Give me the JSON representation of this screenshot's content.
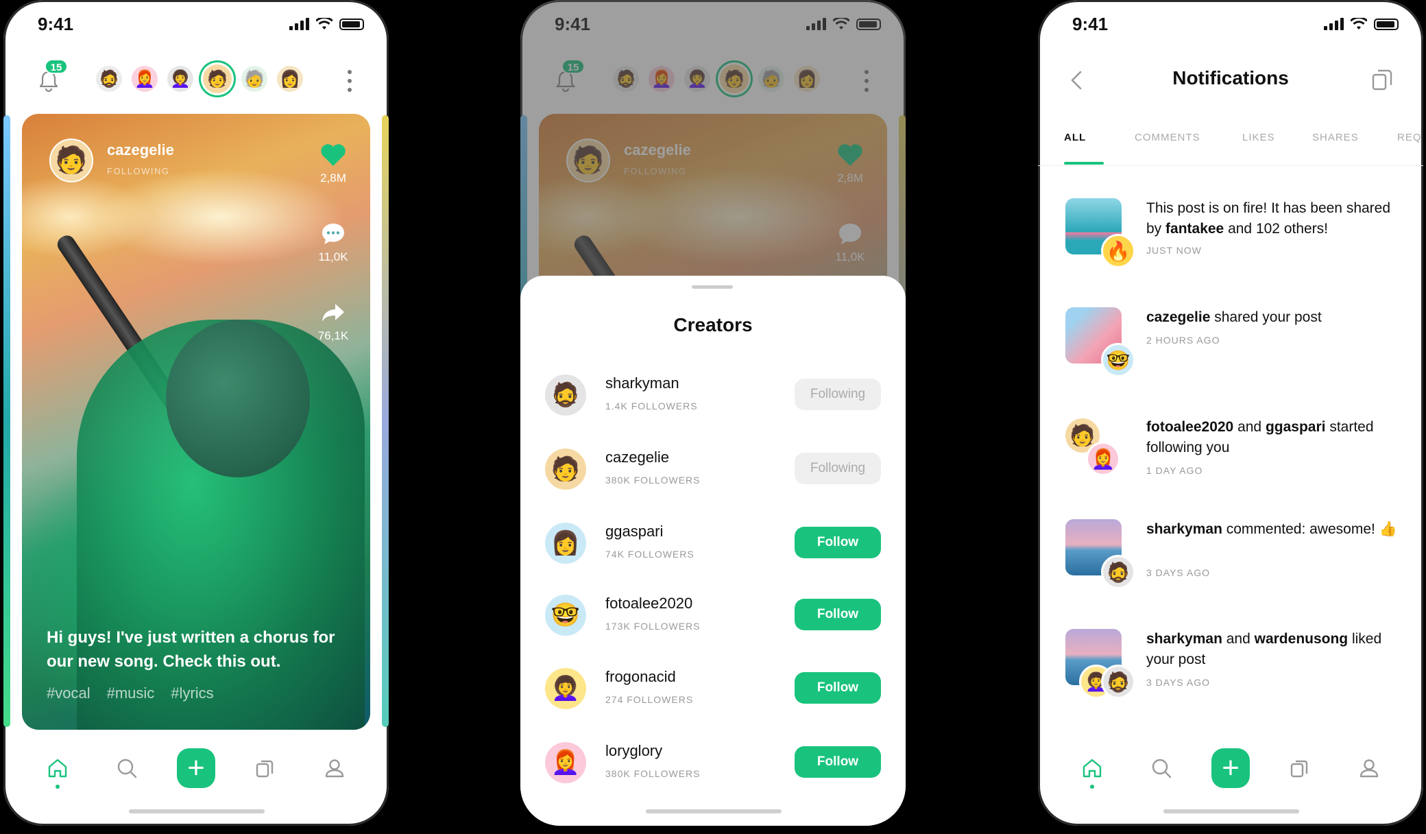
{
  "status": {
    "time": "9:41"
  },
  "feed": {
    "notification_count": "15",
    "stories": [
      "🧔",
      "👩‍🦰",
      "👩‍🦱",
      "🧑",
      "🧓",
      "👩"
    ],
    "post": {
      "username": "cazegelie",
      "follow_state": "FOLLOWING",
      "avatar": "🧑",
      "likes": "2,8M",
      "comments": "11,0K",
      "shares": "76,1K",
      "caption": "Hi guys! I've just written a chorus for our new song. Check this out.",
      "tags": [
        "#vocal",
        "#music",
        "#lyrics"
      ]
    }
  },
  "creators": {
    "title": "Creators",
    "items": [
      {
        "avatar": "🧔",
        "name": "sharkyman",
        "followers": "1.4K FOLLOWERS",
        "button": "Following",
        "following": true,
        "bg": "#e4e4e4"
      },
      {
        "avatar": "🧑",
        "name": "cazegelie",
        "followers": "380K FOLLOWERS",
        "button": "Following",
        "following": true,
        "bg": "#f6d9a2"
      },
      {
        "avatar": "👩",
        "name": "ggaspari",
        "followers": "74K FOLLOWERS",
        "button": "Follow",
        "following": false,
        "bg": "#c9e9f7"
      },
      {
        "avatar": "🤓",
        "name": "fotoalee2020",
        "followers": "173K FOLLOWERS",
        "button": "Follow",
        "following": false,
        "bg": "#c9e9f7"
      },
      {
        "avatar": "👩‍🦱",
        "name": "frogonacid",
        "followers": "274 FOLLOWERS",
        "button": "Follow",
        "following": false,
        "bg": "#fde58a"
      },
      {
        "avatar": "👩‍🦰",
        "name": "loryglory",
        "followers": "380K FOLLOWERS",
        "button": "Follow",
        "following": false,
        "bg": "#fbc9d9"
      }
    ]
  },
  "notifications": {
    "title": "Notifications",
    "tabs": [
      "ALL",
      "COMMENTS",
      "LIKES",
      "SHARES",
      "REQ"
    ],
    "items": [
      {
        "pre": "This post is on fire! It has been shared by ",
        "b1": "fantakee",
        "mid": " and 102 others!",
        "b2": "",
        "post": "",
        "time": "JUST NOW",
        "badge": "🔥",
        "badge_bg": "#ffd54a"
      },
      {
        "pre": "",
        "b1": "cazegelie",
        "mid": " shared your post",
        "b2": "",
        "post": "",
        "time": "2 HOURS AGO",
        "badge": "🤓",
        "badge_bg": "#c9e9f7"
      },
      {
        "pre": "",
        "b1": "fotoalee2020",
        "mid": " and ",
        "b2": "ggaspari",
        "post": " started following you",
        "time": "1 DAY AGO",
        "badge": "👩‍🦰",
        "badge_bg": "#fbc9d9"
      },
      {
        "pre": "",
        "b1": "sharkyman",
        "mid": " commented: awesome! 👍",
        "b2": "",
        "post": "",
        "time": "3 DAYS AGO",
        "badge": "🧔",
        "badge_bg": "#e4e4e4"
      },
      {
        "pre": "",
        "b1": "sharkyman",
        "mid": " and ",
        "b2": "wardenusong",
        "post": " liked your post",
        "time": "3 DAYS AGO",
        "badge": "🧔",
        "badge_bg": "#e4e4e4"
      }
    ]
  },
  "colors": {
    "accent": "#19c37d"
  }
}
